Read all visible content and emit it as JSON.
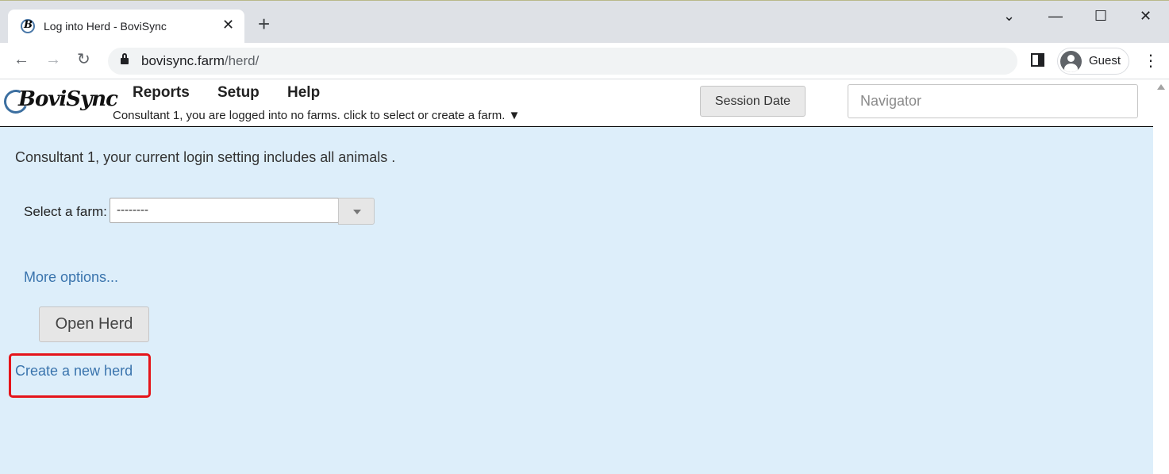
{
  "browser": {
    "tab_title": "Log into Herd - BoviSync",
    "url_host": "bovisync.farm",
    "url_path": "/herd/",
    "profile_label": "Guest"
  },
  "app": {
    "logo_text": "BoviSync",
    "menu": [
      "Reports",
      "Setup",
      "Help"
    ],
    "farm_status": "Consultant 1, you are logged into no farms. click to select or create a farm. ▼",
    "session_date_label": "Session Date",
    "navigator_placeholder": "Navigator"
  },
  "main": {
    "login_message": "Consultant 1, your current login setting includes all animals .",
    "select_farm_label": "Select a farm:",
    "select_farm_value": "--------",
    "more_options_label": "More options...",
    "open_herd_label": "Open Herd",
    "create_herd_label": "Create a new herd"
  },
  "colors": {
    "content_bg": "#ddeefa",
    "link": "#3a74ad",
    "highlight": "#e5141a"
  }
}
